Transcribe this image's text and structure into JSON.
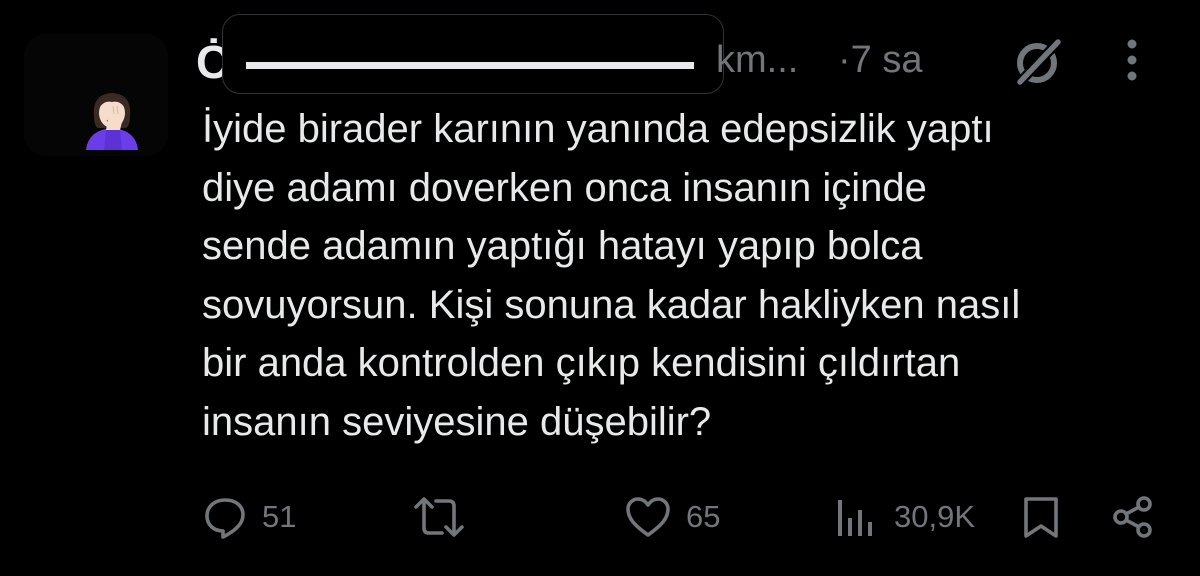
{
  "tweet": {
    "author_initial": "Ċ",
    "handle_suffix": "km...",
    "timestamp": "·7 sa",
    "body_lines": [
      "İyide birader karının yanında edepsizlik yaptı",
      "diye adamı doverken onca insanın içinde",
      "sende adamın yaptığı hatayı yapıp bolca",
      "sovuyorsun. Kişi sonuna kadar hakliyken nasıl",
      "bir anda kontrolden çıkıp kendisini çıldırtan",
      "insanın seviyesine düşebilir?"
    ]
  },
  "actions": {
    "replies": "51",
    "retweets": "",
    "likes": "65",
    "views": "30,9K"
  },
  "icons": {
    "header": [
      "grok-icon",
      "more-icon"
    ],
    "actions": [
      "reply-icon",
      "retweet-icon",
      "like-icon",
      "views-icon",
      "bookmark-icon",
      "share-icon"
    ],
    "avatar": "facepalm-emoji"
  },
  "colors": {
    "background": "#000000",
    "text": "#e7e9ea",
    "secondary_text": "#71767b",
    "avatar_purple": "#5b32d6"
  }
}
